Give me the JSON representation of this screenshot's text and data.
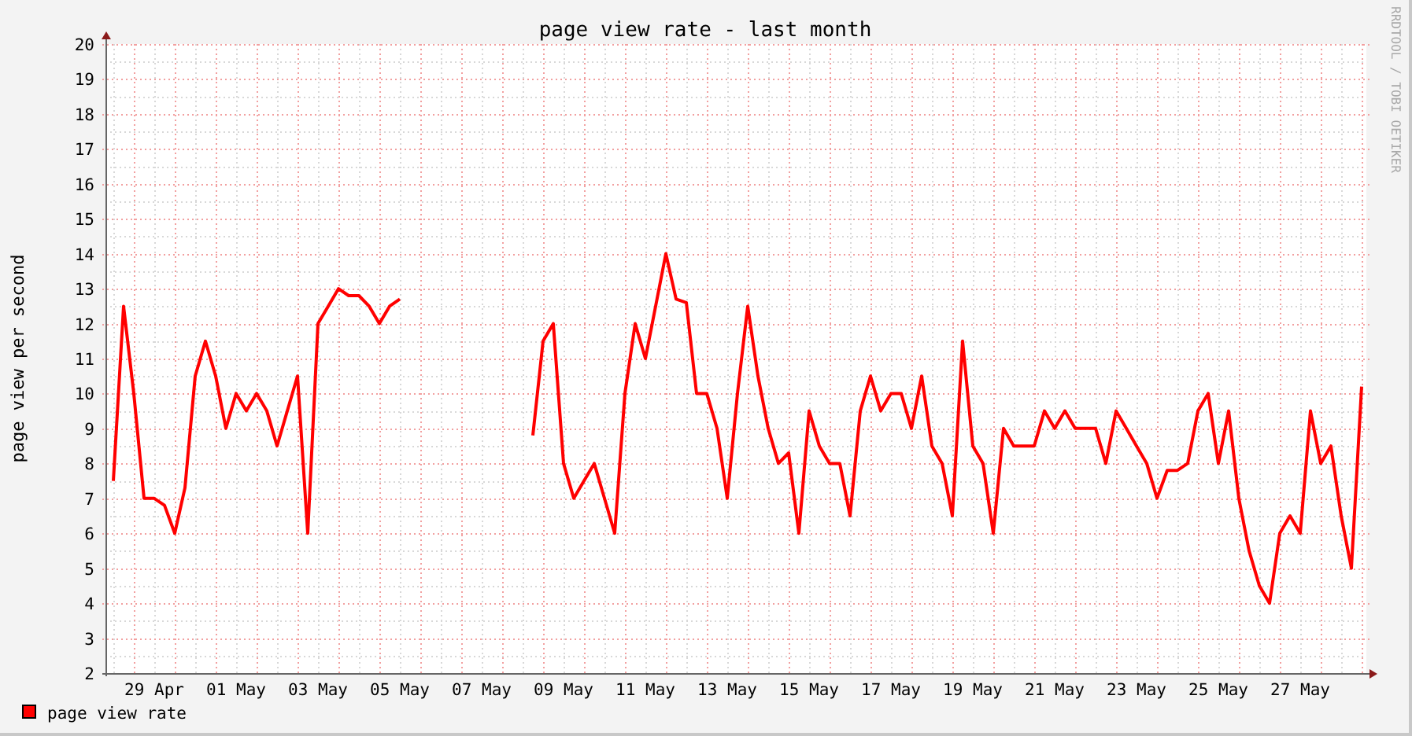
{
  "chart_data": {
    "type": "line",
    "title": "page view rate - last month",
    "ylabel": "page view per second",
    "categories": [
      null,
      null,
      null,
      null,
      "29 Apr",
      null,
      null,
      null,
      null,
      null,
      null,
      null,
      "01 May",
      null,
      null,
      null,
      null,
      null,
      null,
      null,
      "03 May",
      null,
      null,
      null,
      null,
      null,
      null,
      null,
      "05 May",
      null,
      null,
      null,
      null,
      null,
      null,
      null,
      "07 May",
      null,
      null,
      null,
      null,
      null,
      null,
      null,
      "09 May",
      null,
      null,
      null,
      null,
      null,
      null,
      null,
      "11 May",
      null,
      null,
      null,
      null,
      null,
      null,
      null,
      "13 May",
      null,
      null,
      null,
      null,
      null,
      null,
      null,
      "15 May",
      null,
      null,
      null,
      null,
      null,
      null,
      null,
      "17 May",
      null,
      null,
      null,
      null,
      null,
      null,
      null,
      "19 May",
      null,
      null,
      null,
      null,
      null,
      null,
      null,
      "21 May",
      null,
      null,
      null,
      null,
      null,
      null,
      null,
      "23 May",
      null,
      null,
      null,
      null,
      null,
      null,
      null,
      "25 May",
      null,
      null,
      null,
      null,
      null,
      null,
      null,
      "27 May",
      null,
      null,
      null,
      null,
      null,
      null
    ],
    "series": [
      {
        "name": "page view rate",
        "color": "#ff0000",
        "values": [
          7.5,
          12.5,
          10,
          7,
          7,
          6.8,
          6,
          7.3,
          10.5,
          11.5,
          10.5,
          9,
          10,
          9.5,
          10,
          9.5,
          8.5,
          9.5,
          10.5,
          6,
          12,
          12.5,
          13,
          12.8,
          12.8,
          12.5,
          12,
          12.5,
          12.7,
          null,
          null,
          null,
          null,
          null,
          null,
          null,
          null,
          null,
          null,
          null,
          null,
          8.8,
          11.5,
          12,
          8,
          7,
          7.5,
          8,
          7,
          6,
          10,
          12,
          11,
          12.5,
          14,
          12.7,
          12.6,
          10,
          10,
          9,
          7,
          10,
          12.5,
          10.5,
          9,
          8,
          8.3,
          6,
          9.5,
          8.5,
          8,
          8,
          6.5,
          9.5,
          10.5,
          9.5,
          10,
          10,
          9,
          10.5,
          8.5,
          8,
          6.5,
          11.5,
          8.5,
          8,
          6,
          9,
          8.5,
          8.5,
          8.5,
          9.5,
          9,
          9.5,
          9,
          9,
          9,
          8,
          9.5,
          9,
          8.5,
          8,
          7,
          7.8,
          7.8,
          8,
          9.5,
          10,
          8,
          9.5,
          7,
          5.5,
          4.5,
          4,
          6,
          6.5,
          6,
          9.5,
          8,
          8.5,
          6.5,
          5,
          10.2
        ]
      }
    ],
    "ylim": [
      2,
      20
    ],
    "grid": true,
    "yticks": [
      2,
      3,
      4,
      5,
      6,
      7,
      8,
      9,
      10,
      11,
      12,
      13,
      14,
      15,
      16,
      17,
      18,
      19,
      20
    ]
  },
  "credit": "RRDTOOL / TOBI OETIKER"
}
